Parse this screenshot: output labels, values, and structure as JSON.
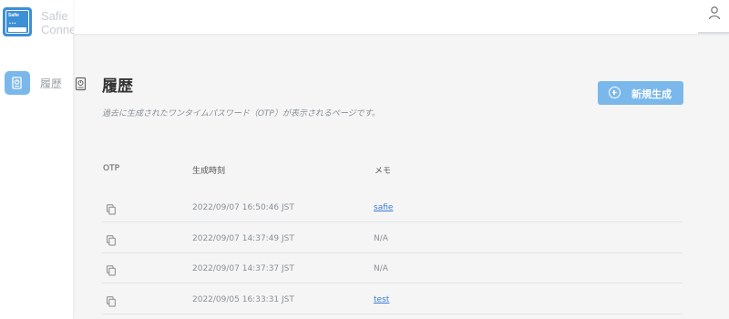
{
  "sidebar": {
    "logo_lines": [
      "Safie",
      "Connect"
    ],
    "logo_badge_text": "Safie",
    "nav_items": [
      {
        "label": "履歴",
        "icon": "history-icon",
        "active": true
      }
    ]
  },
  "header": {
    "user_icon": "user-icon"
  },
  "page": {
    "title": "履歴",
    "description": "過去に生成されたワンタイムパスワード（OTP）が表示されるページです。",
    "new_button_label": "新規生成"
  },
  "table": {
    "headers": {
      "otp": "OTP",
      "time": "生成時刻",
      "memo": "メモ"
    },
    "rows": [
      {
        "time": "2022/09/07 16:50:46 JST",
        "memo": "safie",
        "memo_is_link": true
      },
      {
        "time": "2022/09/07 14:37:49 JST",
        "memo": "N/A",
        "memo_is_link": false
      },
      {
        "time": "2022/09/07 14:37:37 JST",
        "memo": "N/A",
        "memo_is_link": false
      },
      {
        "time": "2022/09/05 16:33:31 JST",
        "memo": "test",
        "memo_is_link": true
      }
    ]
  },
  "colors": {
    "accent": "#7ab8ec",
    "logo": "#3d8fd6",
    "link": "#3a7bd5"
  }
}
